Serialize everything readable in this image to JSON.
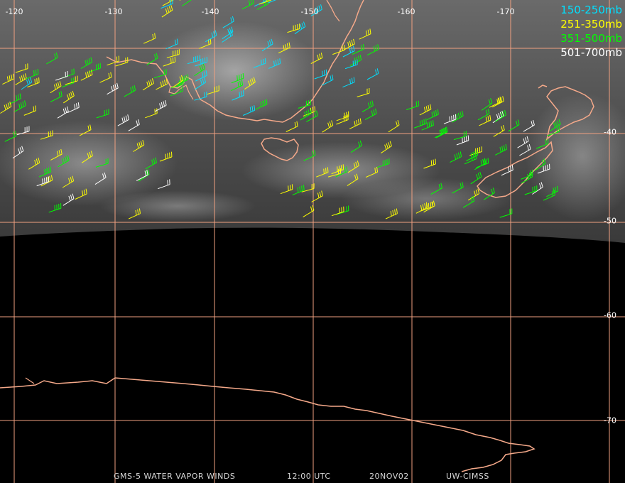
{
  "map": {
    "background_color": "#000000",
    "grid_color": "#f0a080",
    "coast_color": "#f5a98a",
    "longitude_labels": [
      "-120",
      "-130",
      "-140",
      "-150",
      "-160",
      "-170"
    ],
    "latitude_labels": [
      "-40",
      "-50",
      "-60",
      "-70"
    ]
  },
  "legend": {
    "items": [
      {
        "label": "150-250mb",
        "color": "#00e0ff"
      },
      {
        "label": "251-350mb",
        "color": "#ffff00"
      },
      {
        "label": "351-500mb",
        "color": "#00ff00"
      },
      {
        "label": "501-700mb",
        "color": "#ffffff"
      }
    ]
  },
  "footer": {
    "product": "GMS-5 WATER VAPOR WINDS",
    "time": "12:00 UTC",
    "date": "20NOV02",
    "source": "UW-CIMSS"
  }
}
